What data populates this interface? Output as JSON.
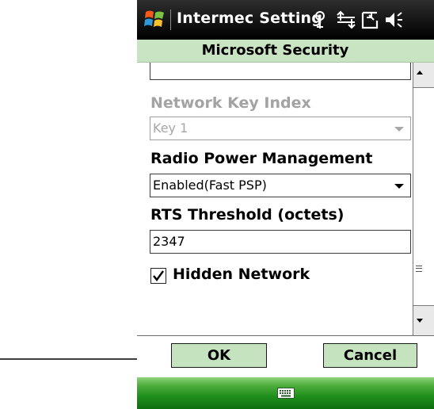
{
  "titlebar": {
    "app_title": "Intermec Setting",
    "icons": [
      "windows-start-icon",
      "signal-icon",
      "sync-arrows-icon",
      "connection-icon",
      "volume-icon"
    ]
  },
  "page": {
    "title": "Microsoft Security"
  },
  "fields": {
    "network_key_value": "",
    "network_key_index_label": "Network Key Index",
    "network_key_index_value": "Key 1",
    "radio_power_label": "Radio Power Management",
    "radio_power_value": "Enabled(Fast PSP)",
    "rts_label": "RTS Threshold (octets)",
    "rts_value": "2347",
    "hidden_network_label": "Hidden Network",
    "hidden_network_checked": true
  },
  "buttons": {
    "ok_label": "OK",
    "cancel_label": "Cancel"
  },
  "colors": {
    "header_bg": "#c9e4c3",
    "button_bg": "#c5e3bf",
    "menubar_green": "#1f8f1c",
    "disabled_text": "#a3a3a3"
  }
}
